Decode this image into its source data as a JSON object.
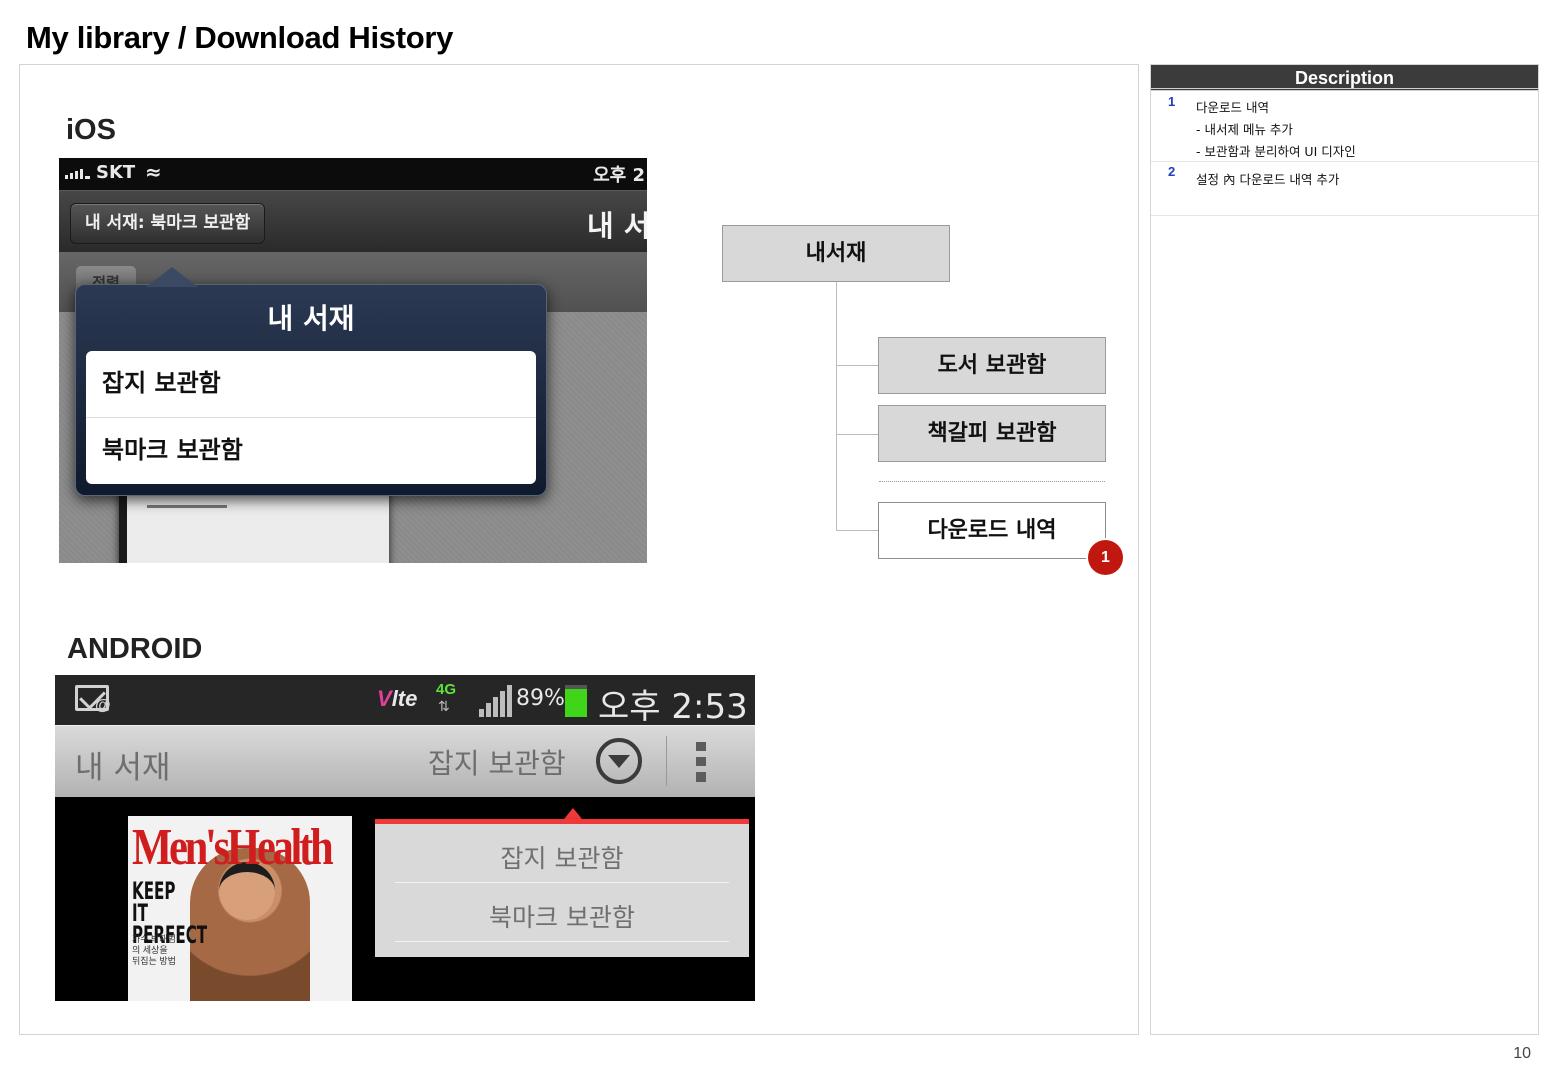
{
  "page": {
    "title": "My library / Download History",
    "page_number": "10"
  },
  "ios": {
    "label": "iOS",
    "status": {
      "carrier": "SKT",
      "time": "오후 2"
    },
    "nav": {
      "back_button": "내 서재: 북마크 보관함",
      "title": "내 서"
    },
    "toolbar": {
      "sort_button": "정렬"
    },
    "popover": {
      "title": "내 서재",
      "items": [
        "잡지 보관함",
        "북마크 보관함"
      ]
    }
  },
  "android": {
    "label": "ANDROID",
    "status": {
      "volte": "lte",
      "network": "4G",
      "battery": "89%",
      "time": "오후 2:53"
    },
    "actionbar": {
      "title": "내 서재",
      "selected": "잡지 보관함"
    },
    "cover": {
      "logo": "Men'sHealth",
      "headline": "KEEP IT PERFECT",
      "caption": "가수 박재범의 세상을 뒤집는 방법"
    },
    "dropdown": {
      "items": [
        "잡지 보관함",
        "북마크 보관함"
      ]
    }
  },
  "diagram": {
    "root": "내서재",
    "children": [
      "도서 보관함",
      "책갈피 보관함",
      "다운로드 내역"
    ],
    "marker": "1"
  },
  "description": {
    "header": "Description",
    "items": [
      {
        "num": "1",
        "lines": [
          "다운로드 내역",
          "- 내서제 메뉴 추가",
          "- 보관함과 분리하여 UI 디자인"
        ]
      },
      {
        "num": "2",
        "lines": [
          "설정 內 다운로드 내역 추가"
        ]
      }
    ]
  }
}
